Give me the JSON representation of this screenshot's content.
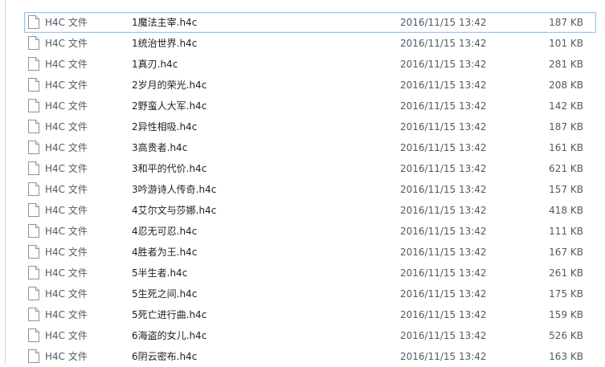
{
  "file_list": {
    "rows": [
      {
        "type": "H4C 文件",
        "name": "1魔法主宰.h4c",
        "date": "2016/11/15 13:42",
        "size": "187 KB",
        "selected": true
      },
      {
        "type": "H4C 文件",
        "name": "1统治世界.h4c",
        "date": "2016/11/15 13:42",
        "size": "101 KB"
      },
      {
        "type": "H4C 文件",
        "name": "1真刃.h4c",
        "date": "2016/11/15 13:42",
        "size": "281 KB"
      },
      {
        "type": "H4C 文件",
        "name": "2岁月的荣光.h4c",
        "date": "2016/11/15 13:42",
        "size": "208 KB"
      },
      {
        "type": "H4C 文件",
        "name": "2野蛮人大军.h4c",
        "date": "2016/11/15 13:42",
        "size": "142 KB"
      },
      {
        "type": "H4C 文件",
        "name": "2异性相吸.h4c",
        "date": "2016/11/15 13:42",
        "size": "187 KB"
      },
      {
        "type": "H4C 文件",
        "name": "3高贵者.h4c",
        "date": "2016/11/15 13:42",
        "size": "161 KB"
      },
      {
        "type": "H4C 文件",
        "name": "3和平的代价.h4c",
        "date": "2016/11/15 13:42",
        "size": "621 KB"
      },
      {
        "type": "H4C 文件",
        "name": "3吟游诗人传奇.h4c",
        "date": "2016/11/15 13:42",
        "size": "157 KB"
      },
      {
        "type": "H4C 文件",
        "name": "4艾尔文与莎娜.h4c",
        "date": "2016/11/15 13:42",
        "size": "418 KB"
      },
      {
        "type": "H4C 文件",
        "name": "4忍无可忍.h4c",
        "date": "2016/11/15 13:42",
        "size": "111 KB"
      },
      {
        "type": "H4C 文件",
        "name": "4胜者为王.h4c",
        "date": "2016/11/15 13:42",
        "size": "167 KB"
      },
      {
        "type": "H4C 文件",
        "name": "5半生者.h4c",
        "date": "2016/11/15 13:42",
        "size": "261 KB"
      },
      {
        "type": "H4C 文件",
        "name": "5生死之间.h4c",
        "date": "2016/11/15 13:42",
        "size": "175 KB"
      },
      {
        "type": "H4C 文件",
        "name": "5死亡进行曲.h4c",
        "date": "2016/11/15 13:42",
        "size": "159 KB"
      },
      {
        "type": "H4C 文件",
        "name": "6海盗的女儿.h4c",
        "date": "2016/11/15 13:42",
        "size": "526 KB"
      },
      {
        "type": "H4C 文件",
        "name": "6阴云密布.h4c",
        "date": "2016/11/15 13:42",
        "size": "163 KB"
      }
    ],
    "icon": "file-icon",
    "colors": {
      "selection_border": "#99c5f0",
      "text": "#1e1e1e",
      "muted_text": "#4f5b66"
    }
  }
}
